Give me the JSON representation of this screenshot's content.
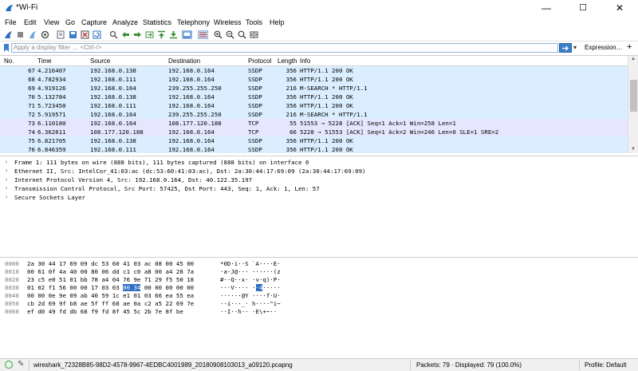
{
  "window": {
    "title": "*Wi-Fi",
    "minimize": "—",
    "maximize": "☐",
    "close": "✕"
  },
  "menu": [
    "File",
    "Edit",
    "View",
    "Go",
    "Capture",
    "Analyze",
    "Statistics",
    "Telephony",
    "Wireless",
    "Tools",
    "Help"
  ],
  "filter": {
    "placeholder": "Apply a display filter … <Ctrl-/>",
    "expression": "Expression…",
    "plus": "+"
  },
  "packet_list": {
    "headers": {
      "no": "No.",
      "time": "Time",
      "source": "Source",
      "destination": "Destination",
      "protocol": "Protocol",
      "length": "Length",
      "info": "Info"
    },
    "rows": [
      {
        "no": "67",
        "time": "4.216407",
        "src": "192.168.0.138",
        "dst": "192.168.0.164",
        "proto": "SSDP",
        "len": "356",
        "info": "HTTP/1.1 200 OK",
        "color": "#daeeff"
      },
      {
        "no": "68",
        "time": "4.782934",
        "src": "192.168.0.111",
        "dst": "192.168.0.164",
        "proto": "SSDP",
        "len": "356",
        "info": "HTTP/1.1 200 OK",
        "color": "#daeeff"
      },
      {
        "no": "69",
        "time": "4.919126",
        "src": "192.168.0.164",
        "dst": "239.255.255.250",
        "proto": "SSDP",
        "len": "216",
        "info": "M-SEARCH * HTTP/1.1",
        "color": "#daeeff"
      },
      {
        "no": "70",
        "time": "5.132784",
        "src": "192.168.0.138",
        "dst": "192.168.0.164",
        "proto": "SSDP",
        "len": "356",
        "info": "HTTP/1.1 200 OK",
        "color": "#daeeff"
      },
      {
        "no": "71",
        "time": "5.723450",
        "src": "192.168.0.111",
        "dst": "192.168.0.164",
        "proto": "SSDP",
        "len": "356",
        "info": "HTTP/1.1 200 OK",
        "color": "#daeeff"
      },
      {
        "no": "72",
        "time": "5.919571",
        "src": "192.168.0.164",
        "dst": "239.255.255.250",
        "proto": "SSDP",
        "len": "216",
        "info": "M-SEARCH * HTTP/1.1",
        "color": "#daeeff"
      },
      {
        "no": "73",
        "time": "6.110180",
        "src": "192.168.0.164",
        "dst": "108.177.120.188",
        "proto": "TCP",
        "len": "55",
        "info": "51553 → 5228 [ACK] Seq=1 Ack=1 Win=258 Len=1",
        "color": "#e7e6ff"
      },
      {
        "no": "74",
        "time": "6.362611",
        "src": "108.177.120.188",
        "dst": "192.168.0.164",
        "proto": "TCP",
        "len": "66",
        "info": "5228 → 51553 [ACK] Seq=1 Ack=2 Win=246 Len=0 SLE=1 SRE=2",
        "color": "#e7e6ff"
      },
      {
        "no": "75",
        "time": "6.821705",
        "src": "192.168.0.138",
        "dst": "192.168.0.164",
        "proto": "SSDP",
        "len": "356",
        "info": "HTTP/1.1 200 OK",
        "color": "#daeeff"
      },
      {
        "no": "76",
        "time": "6.846359",
        "src": "192.168.0.111",
        "dst": "192.168.0.164",
        "proto": "SSDP",
        "len": "356",
        "info": "HTTP/1.1 200 OK",
        "color": "#daeeff"
      }
    ]
  },
  "details": [
    "Frame 1: 111 bytes on wire (888 bits), 111 bytes captured (888 bits) on interface 0",
    "Ethernet II, Src: IntelCor_41:03:ac (dc:53:60:41:03:ac), Dst: 2a:30:44:17:69:09 (2a:30:44:17:69:09)",
    "Internet Protocol Version 4, Src: 192.168.0.164, Dst: 40.122.35.197",
    "Transmission Control Protocol, Src Port: 57425, Dst Port: 443, Seq: 1, Ack: 1, Len: 57",
    "Secure Sockets Layer"
  ],
  "bytes": [
    {
      "off": "0000",
      "hex": "2a 30 44 17 69 09 dc 53  60 41 03 ac 08 00 45 00",
      "ascii": "*0D·i··S `A····E·"
    },
    {
      "off": "0010",
      "hex": "00 61 0f 4a 40 00 80 06  dd c1 c0 a8 00 a4 28 7a",
      "ascii": "·a·J@··· ······(z"
    },
    {
      "off": "0020",
      "hex": "23 c5 e0 51 01 bb 78 a4  04 76 9e 71 29 f5 50 18",
      "ascii": "#··Q··x· ·v·q)·P·"
    },
    {
      "off": "0030",
      "hex_pre": "01 02 f1 56 00 00 17 03  03 ",
      "hex_hl": "00 34",
      "hex_post": " 00 00 00 00 00",
      "ascii_pre": "···V···· ·",
      "ascii_hl": "·4",
      "ascii_post": "·····"
    },
    {
      "off": "0040",
      "hex": "00 00 0e 9e 09 ab 40 59  1c e1 01 03 66 ea 55 ea",
      "ascii": "······@Y ····f·U·"
    },
    {
      "off": "0050",
      "hex": "cb 2d 69 9f b8 ae 5f ff  68 ae 0a c2 a5 22 69 7e",
      "ascii": "·-i···_· h····\"i~"
    },
    {
      "off": "0060",
      "hex": "ef d0 49 fd db 68 f9 fd  8f 45 5c 2b 7e 8f be",
      "ascii": "··I··h·· ·E\\+~··"
    }
  ],
  "status": {
    "file": "wireshark_72328B85-98D2-4578-9967-4EDBC4001989_20180908103013_a09120.pcapng",
    "packets": "Packets: 79 · Displayed: 79 (100.0%)",
    "profile": "Profile: Default"
  },
  "colors": {
    "accent": "#2f6fc4",
    "udp_row": "#daeeff",
    "tcp_row": "#e7e6ff"
  }
}
